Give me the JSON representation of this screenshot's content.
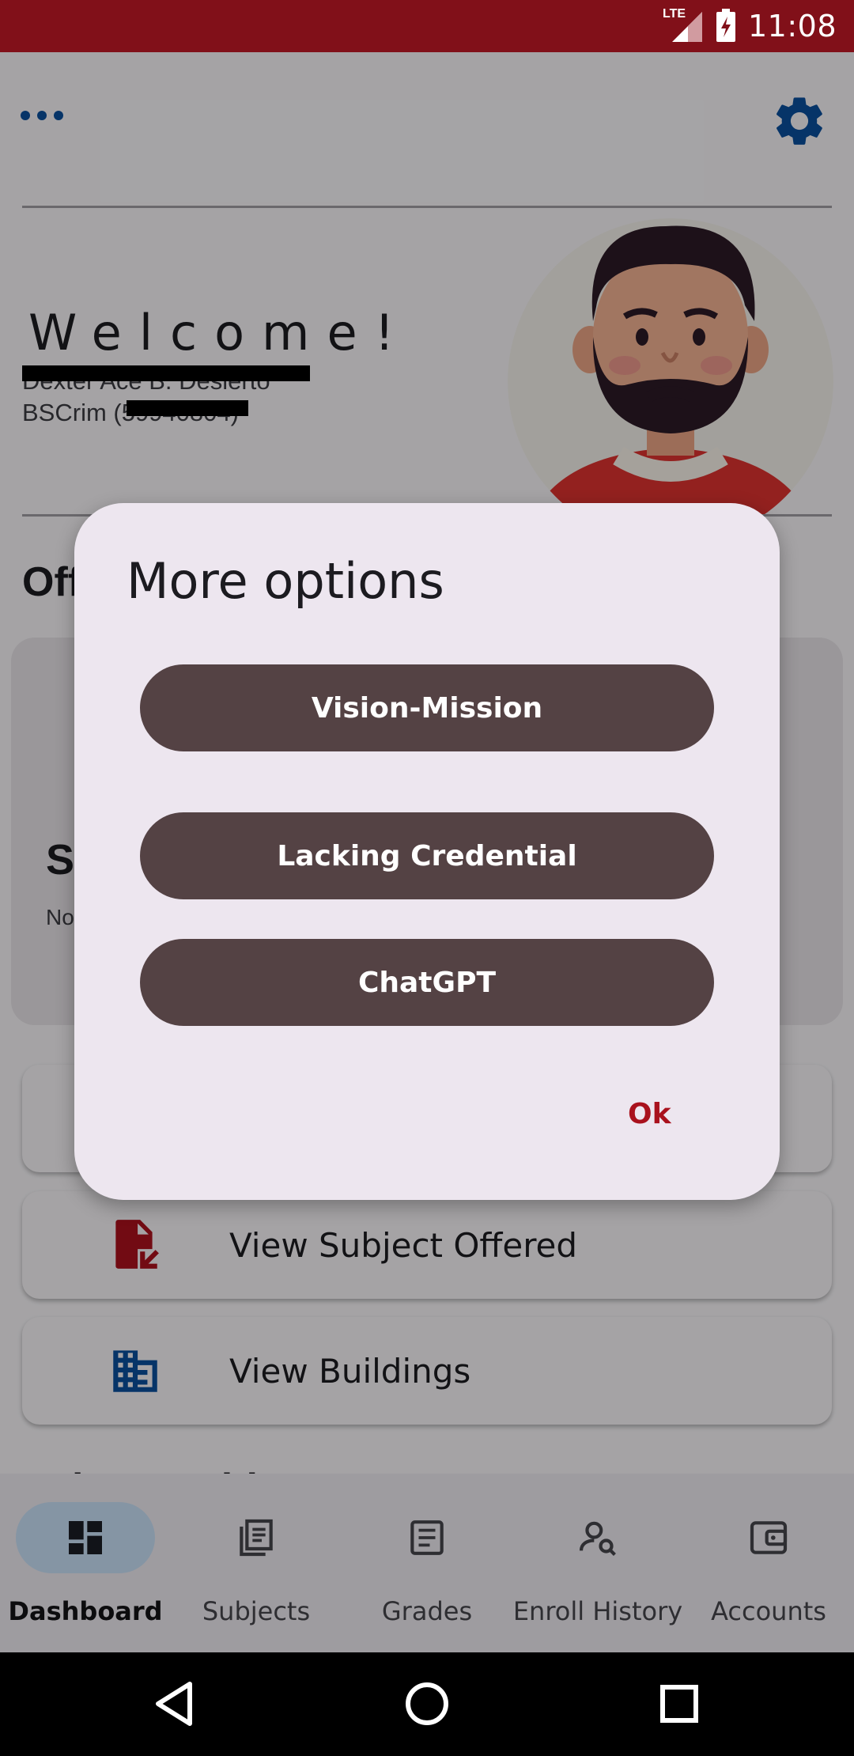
{
  "status_bar": {
    "time": "11:08",
    "network": "LTE"
  },
  "header": {
    "more_icon": "more-horizontal-icon",
    "settings_icon": "gear-icon"
  },
  "profile": {
    "welcome": "Welcome!",
    "name": "Dexter Ace B. Desierto",
    "course": "BSCrim (59940804)"
  },
  "offered": {
    "title": "Offered",
    "card_big": "S",
    "card_small": "No"
  },
  "menu": [
    {
      "label": "View Subject Offered",
      "icon": "file-pointer-icon",
      "color": "#a9111d"
    },
    {
      "label": "View Buildings",
      "icon": "building-icon",
      "color": "#0a4d9a"
    }
  ],
  "partial_heading": "Today's subjects",
  "dialog": {
    "title": "More options",
    "buttons": [
      "Vision-Mission",
      "Lacking Credential",
      "ChatGPT"
    ],
    "ok_label": "Ok"
  },
  "bottom_nav": [
    {
      "label": "Dashboard",
      "icon": "dashboard-icon",
      "active": true
    },
    {
      "label": "Subjects",
      "icon": "subjects-icon",
      "active": false
    },
    {
      "label": "Grades",
      "icon": "grades-icon",
      "active": false
    },
    {
      "label": "Enroll History",
      "icon": "enroll-history-icon",
      "active": false
    },
    {
      "label": "Accounts",
      "icon": "wallet-icon",
      "active": false
    }
  ],
  "colors": {
    "status_bar": "#811019",
    "primary_blue": "#0a4d9a",
    "dialog_button": "#544244",
    "accent_red": "#a9111d"
  }
}
